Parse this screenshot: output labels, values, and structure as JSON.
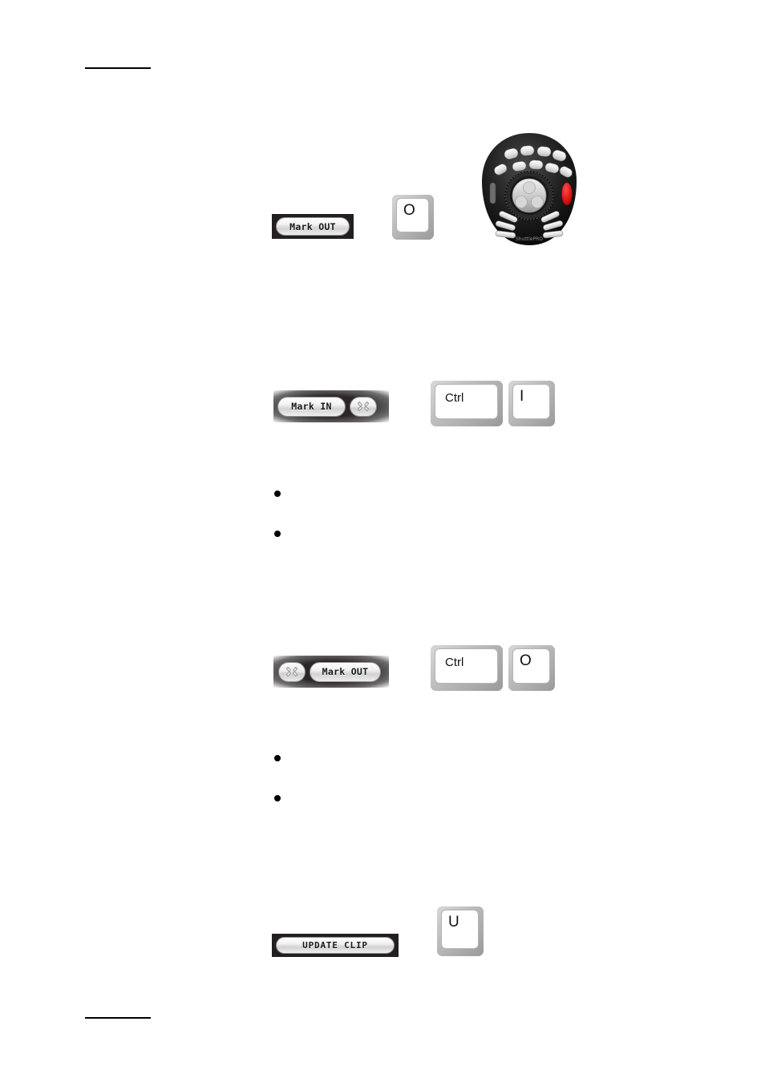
{
  "document": {
    "type": "manual-page",
    "page_background": "#ffffff",
    "header_rule": "—",
    "footer_rule": "—"
  },
  "colors": {
    "panel_dark": "#231f20",
    "pill_face": "#efefef",
    "pill_border": "#8e8e8e",
    "key_body": "#a8a8a8",
    "key_face": "#ffffff",
    "device_body": "#1a1a1a",
    "device_accent_red": "#e01b1b",
    "text": "#000000"
  },
  "sections": [
    {
      "id": "mark-out",
      "button": {
        "label": "Mark OUT",
        "has_clear": false
      },
      "keys": [
        {
          "label": "O",
          "width": "small"
        }
      ],
      "device": "shuttlepro"
    },
    {
      "id": "clear-mark-in",
      "button": {
        "label": "Mark IN",
        "has_clear": true,
        "clear_position": "right",
        "clear_icon": "clear-mark-icon"
      },
      "keys": [
        {
          "label": "Ctrl",
          "width": "wide"
        },
        {
          "label": "I",
          "width": "small"
        }
      ]
    },
    {
      "id": "clear-mark-out",
      "button": {
        "label": "Mark OUT",
        "has_clear": true,
        "clear_position": "left",
        "clear_icon": "clear-mark-icon"
      },
      "keys": [
        {
          "label": "Ctrl",
          "width": "wide"
        },
        {
          "label": "O",
          "width": "small"
        }
      ]
    },
    {
      "id": "update-clip",
      "button": {
        "label": "UPDATE CLIP",
        "has_clear": false
      },
      "keys": [
        {
          "label": "U",
          "width": "small"
        }
      ]
    }
  ],
  "buttons": {
    "mark_out_plain": "Mark OUT",
    "mark_in": "Mark IN",
    "mark_out_clear": "Mark OUT",
    "update_clip": "UPDATE CLIP"
  },
  "keys": {
    "o_top": "O",
    "ctrl_1": "Ctrl",
    "i": "I",
    "ctrl_2": "Ctrl",
    "o_2": "O",
    "u": "U"
  },
  "device": {
    "name": "ShuttlePRO",
    "brand_label": "ShuttlePRO",
    "top_button_rows": [
      4,
      3,
      2
    ],
    "lower_bar_buttons": 6,
    "has_jog_wheel": true,
    "has_shuttle_ring": true,
    "indicator_color": "#e01b1b"
  },
  "bullets": {
    "group_1": [
      "",
      ""
    ],
    "group_2": [
      "",
      ""
    ]
  }
}
